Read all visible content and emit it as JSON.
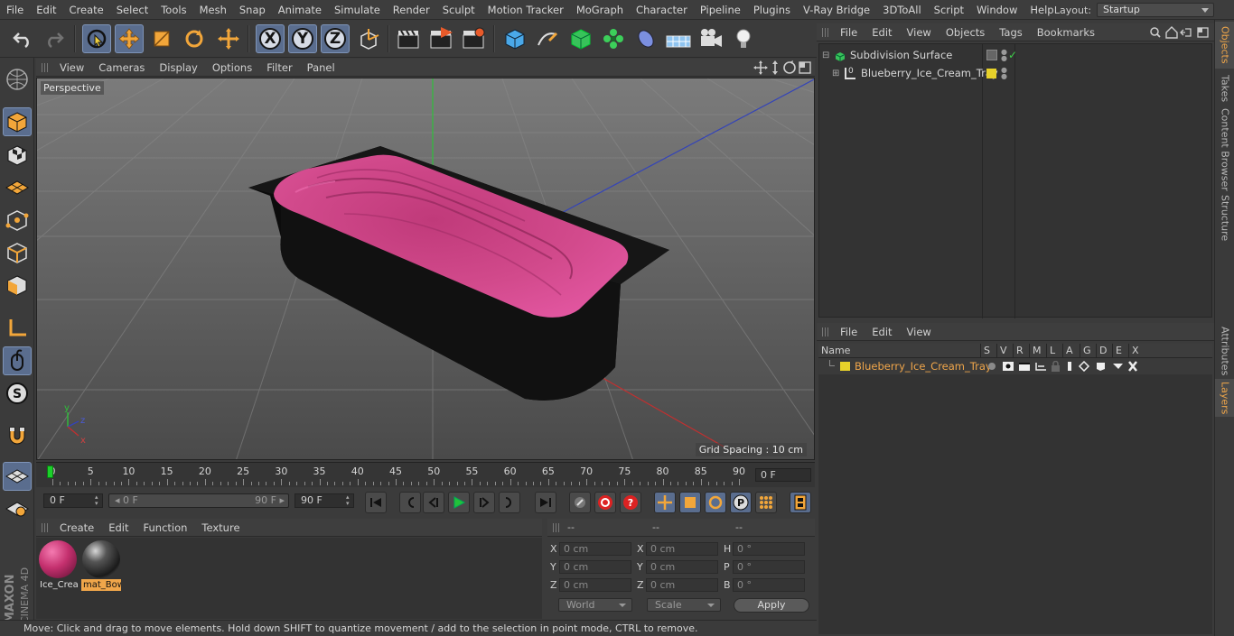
{
  "menubar": {
    "items": [
      "File",
      "Edit",
      "Create",
      "Select",
      "Tools",
      "Mesh",
      "Snap",
      "Animate",
      "Simulate",
      "Render",
      "Sculpt",
      "Motion Tracker",
      "MoGraph",
      "Character",
      "Pipeline",
      "Plugins",
      "V-Ray Bridge",
      "3DToAll",
      "Script",
      "Window",
      "Help"
    ],
    "layout_label": "Layout:",
    "layout_value": "Startup"
  },
  "toolbar": {
    "axis_x": "X",
    "axis_y": "Y",
    "axis_z": "Z"
  },
  "viewport": {
    "menu": [
      "View",
      "Cameras",
      "Display",
      "Options",
      "Filter",
      "Panel"
    ],
    "label": "Perspective",
    "grid_spacing": "Grid Spacing : 10 cm",
    "axis_labels": {
      "y": "y",
      "z": "z",
      "x": "x"
    }
  },
  "timeline": {
    "ticks": [
      "0",
      "5",
      "10",
      "15",
      "20",
      "25",
      "30",
      "35",
      "40",
      "45",
      "50",
      "55",
      "60",
      "65",
      "70",
      "75",
      "80",
      "85",
      "90"
    ],
    "current_frame": "0 F"
  },
  "transport": {
    "start": "0 F",
    "range_start": "◂ 0 F",
    "range_end": "90 F ▸",
    "end": "90 F"
  },
  "materials": {
    "menu": [
      "Create",
      "Edit",
      "Function",
      "Texture"
    ],
    "items": [
      {
        "name": "Ice_Crea",
        "color": "#c4306e"
      },
      {
        "name": "mat_Bow",
        "color": "#2a2a2a"
      }
    ]
  },
  "coords": {
    "headers": [
      "--",
      "--",
      "--"
    ],
    "rows": [
      {
        "l1": "X",
        "v1": "0 cm",
        "l2": "X",
        "v2": "0 cm",
        "l3": "H",
        "v3": "0 °"
      },
      {
        "l1": "Y",
        "v1": "0 cm",
        "l2": "Y",
        "v2": "0 cm",
        "l3": "P",
        "v3": "0 °"
      },
      {
        "l1": "Z",
        "v1": "0 cm",
        "l2": "Z",
        "v2": "0 cm",
        "l3": "B",
        "v3": "0 °"
      }
    ],
    "mode": "World",
    "scale": "Scale",
    "apply": "Apply"
  },
  "status": "Move: Click and drag to move elements. Hold down SHIFT to quantize movement / add to the selection in point mode, CTRL to remove.",
  "objects": {
    "menu": [
      "File",
      "Edit",
      "View",
      "Objects",
      "Tags",
      "Bookmarks"
    ],
    "items": [
      {
        "name": "Subdivision Surface"
      },
      {
        "name": "Blueberry_Ice_Cream_Tray"
      }
    ]
  },
  "layers": {
    "menu": [
      "File",
      "Edit",
      "View"
    ],
    "columns": [
      "Name",
      "S",
      "V",
      "R",
      "M",
      "L",
      "A",
      "G",
      "D",
      "E",
      "X"
    ],
    "items": [
      {
        "name": "Blueberry_Ice_Cream_Tray",
        "color": "#e8d22a"
      }
    ]
  },
  "side_tabs": [
    "Objects",
    "Takes",
    "Content Browser",
    "Structure",
    "Attributes",
    "Layers"
  ],
  "brand": {
    "line1": "MAXON",
    "line2": "CINEMA 4D"
  },
  "colors": {
    "accent_orange": "#f0a64a",
    "active_blue": "#5a6d8e",
    "ice_cream_pink": "#d6408c"
  }
}
